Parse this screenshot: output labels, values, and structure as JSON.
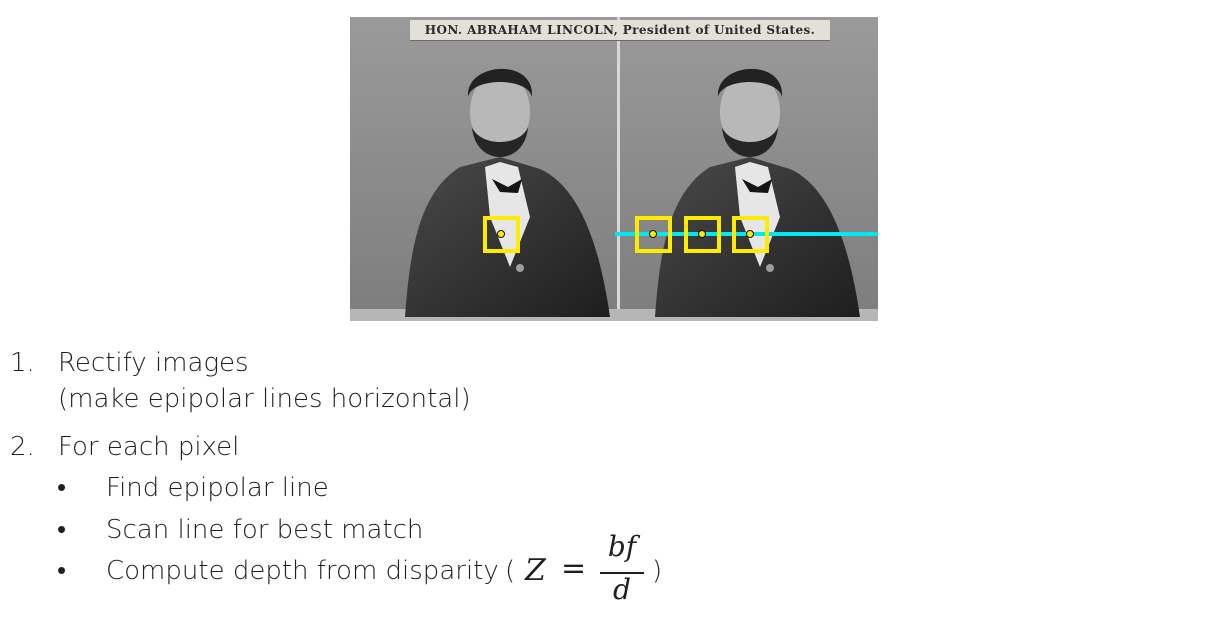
{
  "photo": {
    "caption": "HON. ABRAHAM LINCOLN, President of United States.",
    "colors": {
      "match_box": "#ffeb00",
      "epipolar_line": "#00e8f0"
    }
  },
  "steps": [
    {
      "number": "1.",
      "text": "Rectify images",
      "detail": "(make epipolar lines horizontal)"
    },
    {
      "number": "2.",
      "text": "For each pixel"
    }
  ],
  "bullets": [
    {
      "marker": "•",
      "text": "Find epipolar line"
    },
    {
      "marker": "•",
      "text": "Scan line for best match"
    },
    {
      "marker": "•",
      "text": "Compute depth from disparity"
    }
  ],
  "formula": {
    "open_paren": "(",
    "lhs": "Z",
    "equals": "=",
    "numerator": "bf",
    "denominator": "d",
    "close_paren": ")"
  }
}
